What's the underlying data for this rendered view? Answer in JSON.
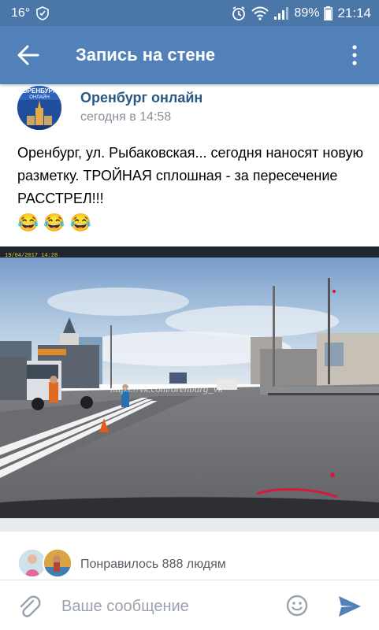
{
  "status_bar": {
    "temperature": "16°",
    "battery": "89%",
    "time": "21:14"
  },
  "app_bar": {
    "title": "Запись на стене"
  },
  "post": {
    "group_name": "Оренбург онлайн",
    "time": "сегодня в 14:58",
    "text": "Оренбург, ул. Рыбаковская... сегодня наносят новую разметку. ТРОЙНАЯ сплошная - за пересечение РАССТРЕЛ!!!",
    "emojis": [
      "😂",
      "😂",
      "😂"
    ],
    "avatar_text": "ОРЕНБУРГ ОНЛАЙН",
    "photo": {
      "watermark": "https://vk.com/orenburg_vk"
    }
  },
  "likes": {
    "text": "Понравилось 888 людям"
  },
  "composer": {
    "placeholder": "Ваше сообщение"
  },
  "colors": {
    "header": "#5181b8",
    "status": "#4a76a8",
    "link": "#2a5885",
    "send": "#5181b8"
  },
  "icons": {
    "back": "arrow-left-icon",
    "more": "more-vertical-icon",
    "attach": "paperclip-icon",
    "emoji": "smile-icon",
    "send": "send-icon"
  }
}
